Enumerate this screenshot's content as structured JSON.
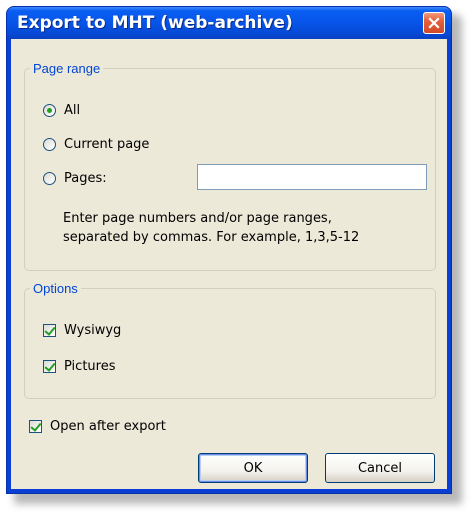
{
  "window": {
    "title": "Export to MHT (web-archive)"
  },
  "page_range": {
    "legend": "Page range",
    "options": [
      {
        "label": "All",
        "checked": true
      },
      {
        "label": "Current page",
        "checked": false
      },
      {
        "label": "Pages:",
        "checked": false
      }
    ],
    "pages_value": "",
    "hint_line1": "Enter page numbers and/or page ranges,",
    "hint_line2": "separated by commas. For example, 1,3,5-12"
  },
  "options": {
    "legend": "Options",
    "wysiwyg_label": "Wysiwyg",
    "wysiwyg_checked": true,
    "pictures_label": "Pictures",
    "pictures_checked": true
  },
  "open_after_export": {
    "label": "Open after export",
    "checked": true
  },
  "buttons": {
    "ok": "OK",
    "cancel": "Cancel"
  },
  "colors": {
    "titlebar": "#0754e8",
    "client_bg": "#ece9d8",
    "legend_text": "#0046d5",
    "check_mark": "#21a121",
    "close_button": "#e2603a"
  }
}
